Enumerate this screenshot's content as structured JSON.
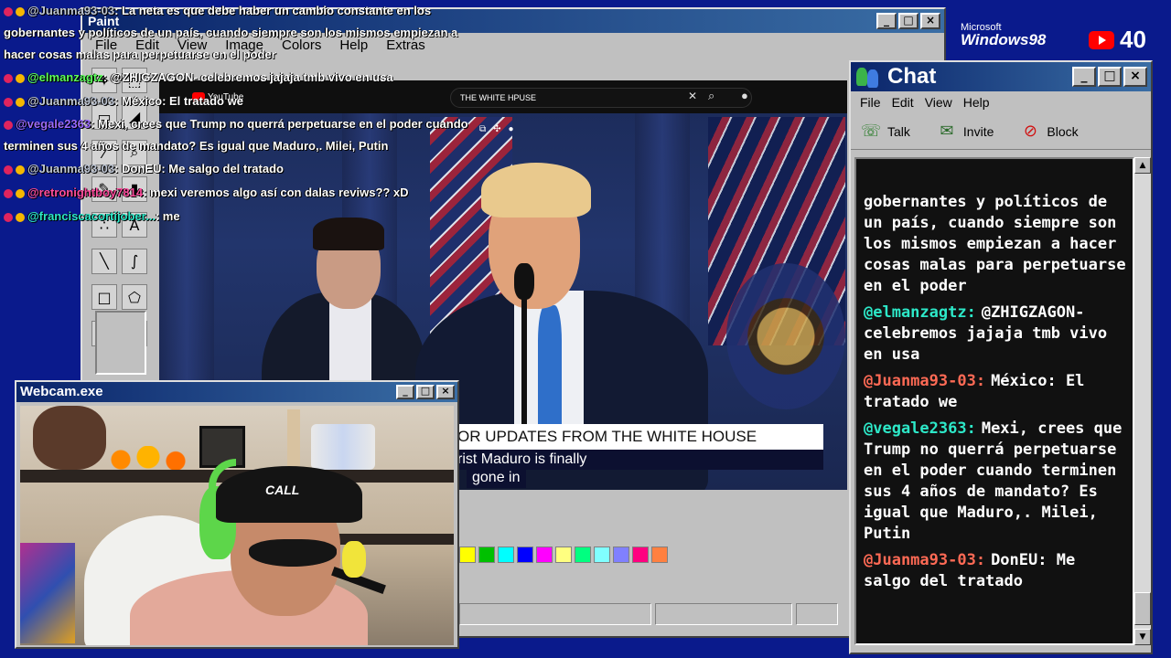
{
  "paint": {
    "title": "Paint",
    "menu": [
      "File",
      "Edit",
      "View",
      "Image",
      "Colors",
      "Help",
      "Extras"
    ],
    "palette": [
      "#ffff00",
      "#00c000",
      "#00ffff",
      "#0000ff",
      "#ff00ff",
      "#ffff80",
      "#00ff80",
      "#80ffff",
      "#8080ff",
      "#ff0080",
      "#ff8040"
    ]
  },
  "youtube": {
    "logo": "YouTube",
    "search": "THE WHITE HPUSE"
  },
  "video": {
    "caption_headline": "OR UPDATES FROM THE WHITE HOUSE",
    "caption_line1": "rist Maduro is finally",
    "caption_line2": "gone in"
  },
  "overlay_chat": [
    {
      "user": "@Juanma93-03",
      "user_color": "gray",
      "text": ": La neta es que debe haber un cambio constante en los gobernantes y políticos de un país, cuando siempre son los mismos empiezan a hacer cosas malas para perpetuarse en el poder"
    },
    {
      "user": "@elmanzagtz",
      "user_color": "green",
      "text": ": @ZHIGZAGON- celebremos jajaja tmb vivo en usa"
    },
    {
      "user": "@Juanma93-03",
      "user_color": "gray",
      "text": ": México: El tratado we"
    },
    {
      "user": "@vegale2363",
      "user_color": "purple",
      "text": ": Mexi, crees que Trump no querrá perpetuarse en el poder cuando terminen sus 4 años de mandato? Es igual que Maduro,. Milei, Putin"
    },
    {
      "user": "@Juanma93-03",
      "user_color": "gray",
      "text": ": DonEU: Me salgo del tratado"
    },
    {
      "user": "@retronightboy7814",
      "user_color": "pink",
      "text": ": mexi veremos algo así con dalas reviws?? xD"
    },
    {
      "user": "@franciscacortijober...",
      "user_color": "teal",
      "text": ": me"
    }
  ],
  "branding": {
    "ms": "Microsoft",
    "windows": "Windows98",
    "viewer_count": "40"
  },
  "chat": {
    "title": "Chat",
    "menu": [
      "File",
      "Edit",
      "View",
      "Help"
    ],
    "toolbar": {
      "talk": "Talk",
      "invite": "Invite",
      "block": "Block"
    },
    "lead_text": "gobernantes y políticos de un país, cuando siempre son los mismos empiezan a hacer cosas malas para perpetuarse en el poder",
    "messages": [
      {
        "user": "@elmanzagtz:",
        "color": "#2de8c8",
        "text": "@ZHIGZAGON- celebremos jajaja tmb vivo en usa"
      },
      {
        "user": "@Juanma93-03:",
        "color": "#ff6a55",
        "text": "México: El tratado we"
      },
      {
        "user": "@vegale2363:",
        "color": "#2de8c8",
        "text": "Mexi, crees que Trump no querrá perpetuarse en el poder cuando terminen sus 4 años de mandato? Es igual que Maduro,. Milei, Putin"
      },
      {
        "user": "@Juanma93-03:",
        "color": "#ff6a55",
        "text": "DonEU: Me salgo del tratado"
      }
    ]
  },
  "webcam": {
    "title": "Webcam.exe",
    "cap_text": "CALL"
  }
}
